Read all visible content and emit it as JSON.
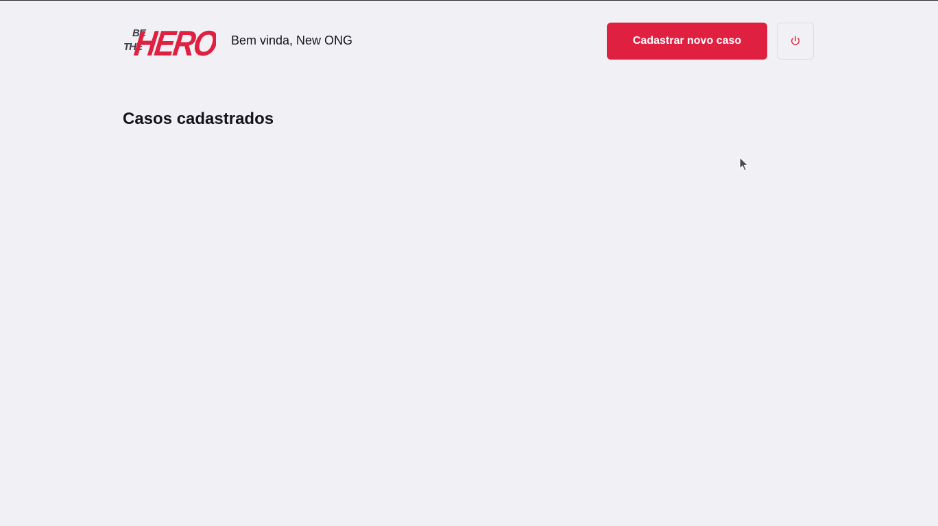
{
  "header": {
    "logo": {
      "text_be": "BE",
      "text_the": "THE",
      "text_hero": "HERO",
      "icon": "be-the-hero-logo"
    },
    "welcome_text": "Bem vinda, New ONG",
    "new_case_button_label": "Cadastrar novo caso",
    "logout_icon": "power-icon"
  },
  "main": {
    "title": "Casos cadastrados",
    "cases": []
  },
  "colors": {
    "background": "#f0f0f5",
    "accent": "#e02041",
    "text": "#13131a",
    "logo_dark": "#41414d"
  }
}
